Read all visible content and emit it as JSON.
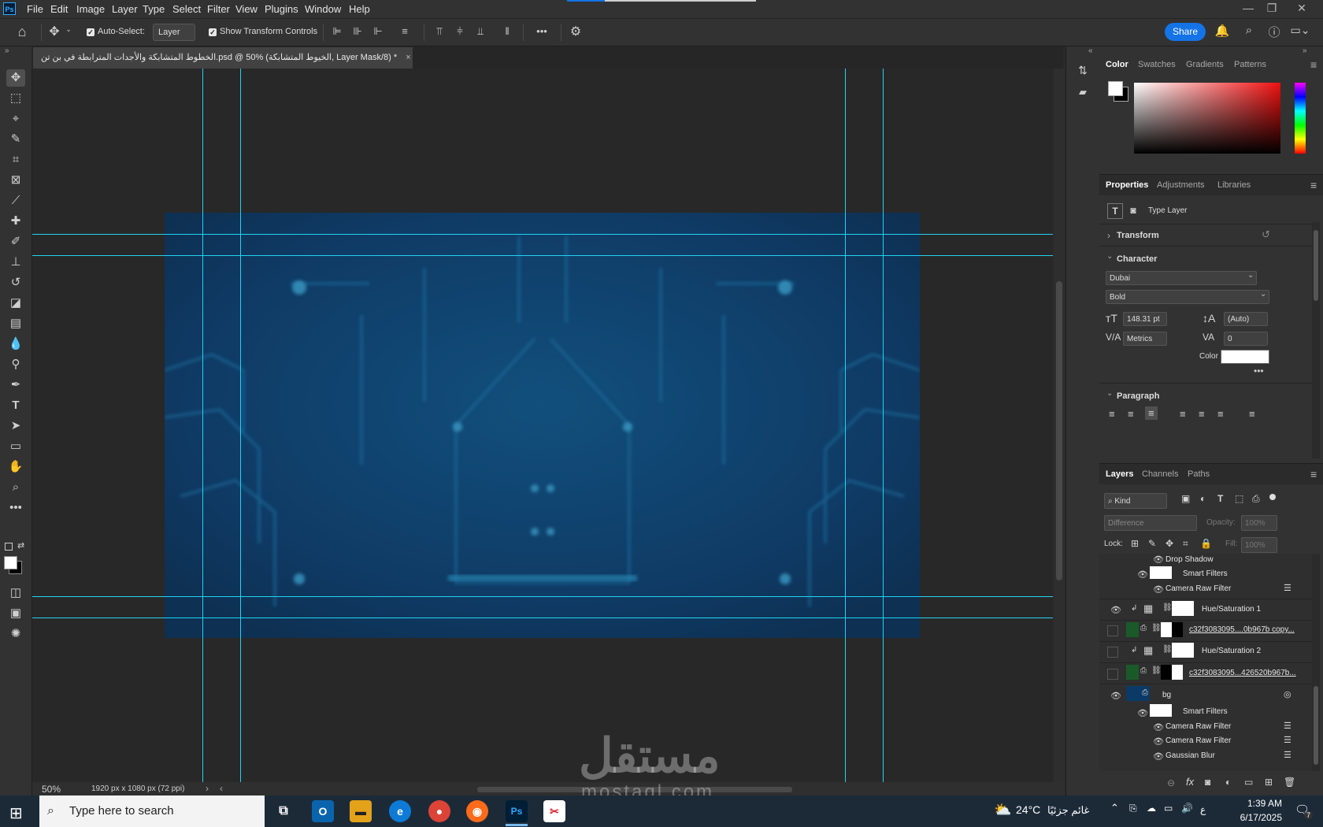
{
  "app": {
    "logo": "Ps"
  },
  "menu": [
    "File",
    "Edit",
    "Image",
    "Layer",
    "Type",
    "Select",
    "Filter",
    "View",
    "Plugins",
    "Window",
    "Help"
  ],
  "options": {
    "auto_select_label": "Auto-Select:",
    "auto_select_value": "Layer",
    "show_transform_label": "Show Transform Controls",
    "share_label": "Share",
    "more": "•••"
  },
  "document": {
    "tab_title": "الخطوط المتشابكة والأجدات المترابطة في بن تن.psd @ 50% (الخيوط المتشابكة, Layer Mask/8) *",
    "close": "×"
  },
  "status": {
    "zoom": "50%",
    "dimensions": "1920 px x 1080 px (72 ppi)"
  },
  "color_panel": {
    "tabs": [
      "Color",
      "Swatches",
      "Gradients",
      "Patterns"
    ],
    "active": "Color"
  },
  "properties_panel": {
    "tabs": [
      "Properties",
      "Adjustments",
      "Libraries"
    ],
    "layer_type": "Type Layer",
    "transform": "Transform",
    "character": "Character",
    "font_family": "Dubai",
    "font_style": "Bold",
    "font_size": "148.31 pt",
    "leading": "(Auto)",
    "kerning": "Metrics",
    "tracking": "0",
    "color_label": "Color",
    "more": "•••",
    "paragraph": "Paragraph"
  },
  "layers_panel": {
    "tabs": [
      "Layers",
      "Channels",
      "Paths"
    ],
    "kind": "Kind",
    "blend_mode": "Difference",
    "opacity_label": "Opacity:",
    "opacity": "100%",
    "lock_label": "Lock:",
    "fill_label": "Fill:",
    "fill": "100%",
    "rows": {
      "drop_shadow": "Drop Shadow",
      "smart_filters_1": "Smart Filters",
      "camera_raw_1": "Camera Raw Filter",
      "hue_sat_1": "Hue/Saturation 1",
      "img_copy": "c32f3083095....0b967b copy...",
      "hue_sat_2": "Hue/Saturation 2",
      "img": "c32f3083095...426520b967b...",
      "bg": "bg",
      "smart_filters_2": "Smart Filters",
      "camera_raw_2": "Camera Raw Filter",
      "camera_raw_3": "Camera Raw Filter",
      "gaussian_blur": "Gaussian Blur"
    }
  },
  "taskbar": {
    "search_placeholder": "Type here to search",
    "weather_temp": "24°C",
    "weather_text": "غائم جزئيًا",
    "lang": "ع",
    "time": "1:39 AM",
    "date": "6/17/2025",
    "notif_count": "7"
  },
  "watermark": {
    "arabic": "مستقل",
    "latin": "mostaql.com"
  }
}
